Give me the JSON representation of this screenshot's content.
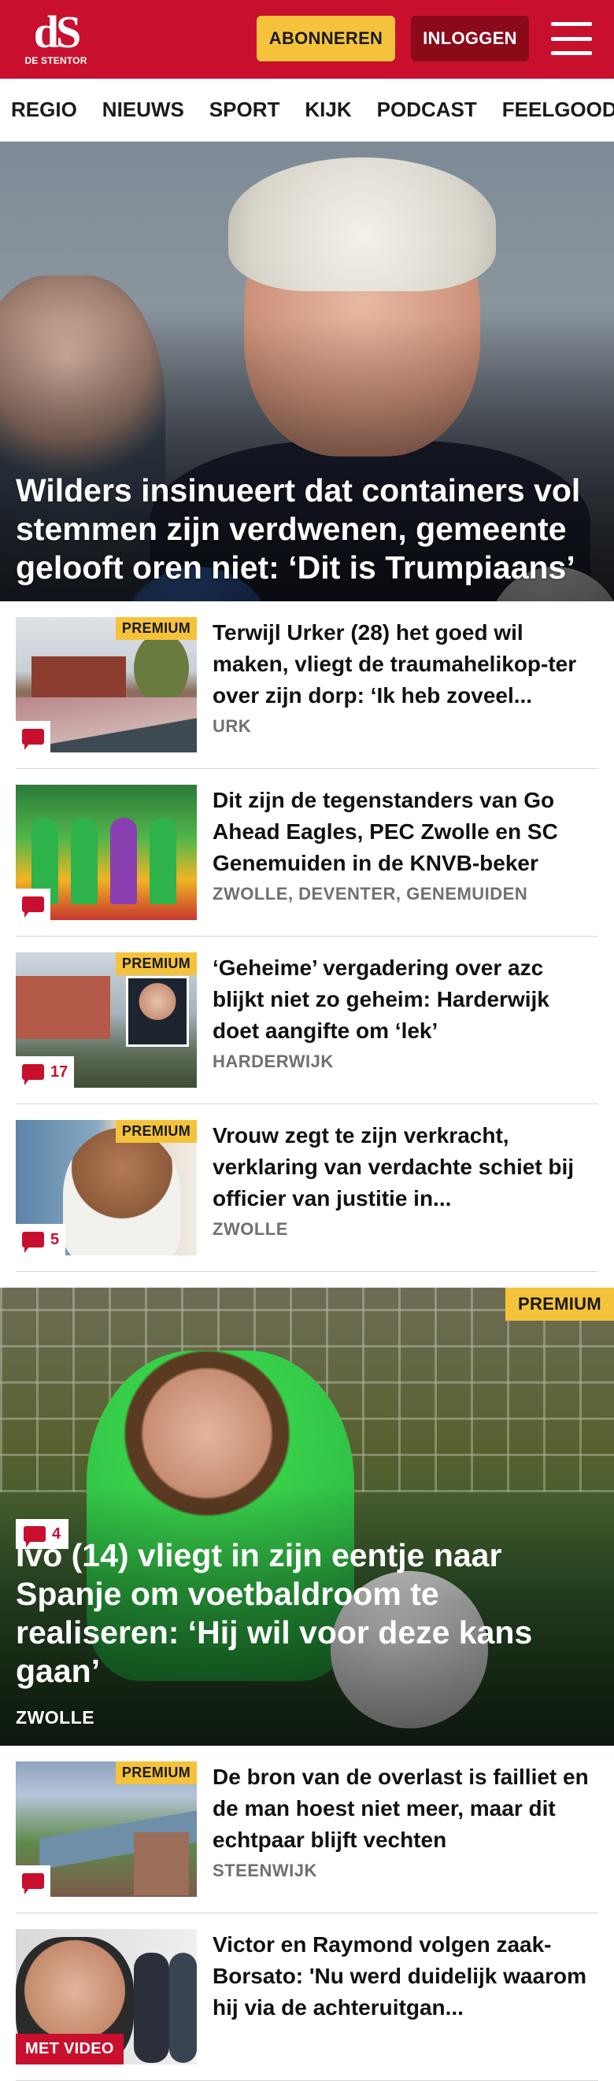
{
  "header": {
    "logo_text": "dS",
    "logo_subtext": "DE STENTOR",
    "subscribe_label": "ABONNEREN",
    "login_label": "INLOGGEN",
    "menu_icon": "hamburger-menu-icon",
    "colors": {
      "brand_red": "#c8102e",
      "accent_yellow": "#f5c33b",
      "login_dark_red": "#8b0a1a"
    }
  },
  "nav": {
    "items": [
      "REGIO",
      "NIEUWS",
      "SPORT",
      "KIJK",
      "PODCAST",
      "FEELGOOD"
    ]
  },
  "hero": {
    "title": "Wilders insinueert dat containers vol stemmen zijn verdwenen, gemeente gelooft oren niet: ‘Dit is Trumpiaans’"
  },
  "articles": [
    {
      "title": "Terwijl Urker (28) het goed wil maken, vliegt de traumahelikop-ter over zijn dorp: ‘Ik heb zoveel...",
      "location": "URK",
      "premium": "PREMIUM",
      "comments": ""
    },
    {
      "title": "Dit zijn de tegenstanders van Go Ahead Eagles, PEC Zwolle en SC Genemuiden in de KNVB-beker",
      "location": "ZWOLLE, DEVENTER, GENEMUIDEN",
      "premium": "",
      "comments": ""
    },
    {
      "title": "‘Geheime’ vergadering over azc blijkt niet zo geheim: Harderwijk doet aangifte om ‘lek’",
      "location": "HARDERWIJK",
      "premium": "PREMIUM",
      "comments": "17"
    },
    {
      "title": "Vrouw zegt te zijn verkracht, verklaring van verdachte schiet bij officier van justitie in...",
      "location": "ZWOLLE",
      "premium": "PREMIUM",
      "comments": "5"
    }
  ],
  "feature": {
    "premium": "PREMIUM",
    "comments": "4",
    "title": "Ivo (14) vliegt in zijn eentje naar Spanje om voetbaldroom te realiseren: ‘Hij wil voor deze kans gaan’",
    "location": "ZWOLLE"
  },
  "articles2": [
    {
      "title": "De bron van de overlast is failliet en de man hoest niet meer, maar dit echtpaar blijft vechten",
      "location": "STEENWIJK",
      "premium": "PREMIUM",
      "comments": ""
    },
    {
      "title": "Victor en Raymond volgen zaak-Borsato: 'Nu werd duidelijk waarom hij via de achteruitgan...",
      "video": "MET VIDEO"
    }
  ]
}
